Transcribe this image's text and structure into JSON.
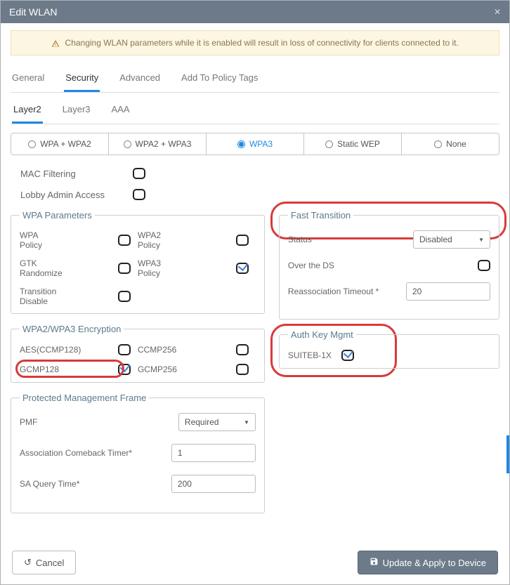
{
  "dialog": {
    "title": "Edit WLAN"
  },
  "warning": "Changing WLAN parameters while it is enabled will result in loss of connectivity for clients connected to it.",
  "tabs_main": {
    "general": "General",
    "security": "Security",
    "advanced": "Advanced",
    "policy": "Add To Policy Tags"
  },
  "tabs_sub": {
    "layer2": "Layer2",
    "layer3": "Layer3",
    "aaa": "AAA"
  },
  "radio": {
    "wpa_wpa2": "WPA + WPA2",
    "wpa2_wpa3": "WPA2 + WPA3",
    "wpa3": "WPA3",
    "static_wep": "Static WEP",
    "none": "None"
  },
  "mac_filtering": "MAC Filtering",
  "lobby_admin": "Lobby Admin Access",
  "wpa_params": {
    "legend": "WPA Parameters",
    "wpa_policy": "WPA\nPolicy",
    "wpa2_policy": "WPA2\nPolicy",
    "gtk": "GTK\nRandomize",
    "wpa3_policy": "WPA3\nPolicy",
    "transition": "Transition\nDisable"
  },
  "encryption": {
    "legend": "WPA2/WPA3 Encryption",
    "aes": "AES(CCMP128)",
    "ccmp256": "CCMP256",
    "gcmp128": "GCMP128",
    "gcmp256": "GCMP256"
  },
  "pmf": {
    "legend": "Protected Management Frame",
    "pmf_label": "PMF",
    "pmf_value": "Required",
    "assoc_label": "Association Comeback Timer*",
    "assoc_value": "1",
    "sa_label": "SA Query Time*",
    "sa_value": "200"
  },
  "ft": {
    "legend": "Fast Transition",
    "status_label": "Status",
    "status_value": "Disabled",
    "over_ds": "Over the DS",
    "reassoc_label": "Reassociation Timeout *",
    "reassoc_value": "20"
  },
  "auth": {
    "legend": "Auth Key Mgmt",
    "suiteb": "SUITEB-1X"
  },
  "footer": {
    "cancel": "Cancel",
    "apply": "Update & Apply to Device"
  }
}
